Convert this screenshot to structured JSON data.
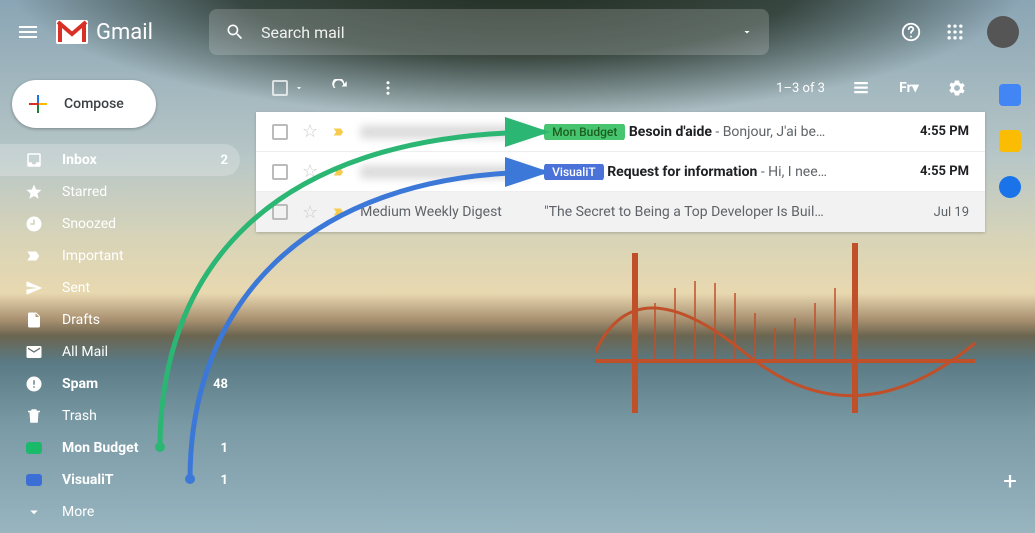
{
  "header": {
    "app_name": "Gmail",
    "search_placeholder": "Search mail"
  },
  "compose_label": "Compose",
  "sidebar": {
    "items": [
      {
        "icon": "inbox",
        "label": "Inbox",
        "count": "2",
        "bold": true,
        "active": true
      },
      {
        "icon": "star",
        "label": "Starred",
        "count": "",
        "bold": false
      },
      {
        "icon": "clock",
        "label": "Snoozed",
        "count": "",
        "bold": false
      },
      {
        "icon": "important",
        "label": "Important",
        "count": "",
        "bold": false
      },
      {
        "icon": "sent",
        "label": "Sent",
        "count": "",
        "bold": false
      },
      {
        "icon": "drafts",
        "label": "Drafts",
        "count": "",
        "bold": false
      },
      {
        "icon": "allmail",
        "label": "All Mail",
        "count": "",
        "bold": false
      },
      {
        "icon": "spam",
        "label": "Spam",
        "count": "48",
        "bold": true
      },
      {
        "icon": "trash",
        "label": "Trash",
        "count": "",
        "bold": false
      },
      {
        "icon": "label",
        "label": "Mon Budget",
        "count": "1",
        "bold": true,
        "color": "#1aba6a"
      },
      {
        "icon": "label",
        "label": "VisualiT",
        "count": "1",
        "bold": true,
        "color": "#3b6fd6"
      },
      {
        "icon": "more",
        "label": "More",
        "count": "",
        "bold": false
      }
    ]
  },
  "toolbar": {
    "range_text": "1–3 of 3"
  },
  "emails": [
    {
      "sender": "",
      "sender_redacted": true,
      "label": "Mon Budget",
      "label_bg": "#46c46f",
      "label_fg": "#1b5e20",
      "subject": "Besoin d'aide",
      "snippet": " - Bonjour, J'ai be…",
      "time": "4:55 PM",
      "read": false,
      "important": true
    },
    {
      "sender": "",
      "sender_redacted": true,
      "label": "VisualiT",
      "label_bg": "#4a72d8",
      "label_fg": "#ffffff",
      "subject": "Request for information",
      "snippet": " - Hi, I nee…",
      "time": "4:55 PM",
      "read": false,
      "important": true
    },
    {
      "sender": "Medium Weekly Digest",
      "sender_redacted": false,
      "label": "",
      "label_bg": "",
      "label_fg": "",
      "subject": "\"The Secret to Being a Top Developer Is Buil…",
      "snippet": "",
      "time": "Jul 19",
      "read": true,
      "important": true
    }
  ],
  "colors": {
    "arrow_green": "#2bb673",
    "arrow_blue": "#3c78d8"
  }
}
